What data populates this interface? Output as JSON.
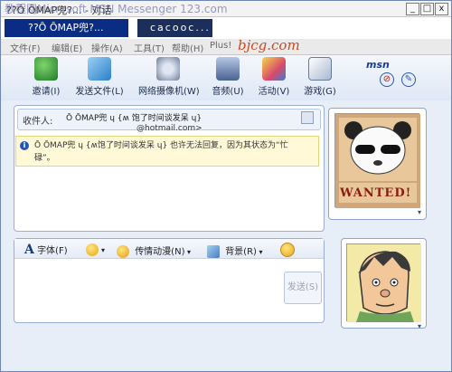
{
  "titlebar": {
    "title": "??Ȏ ȎMAP兜?... - 对话",
    "watermark": "教程网Microsoft MSN Messenger 123.com",
    "min_icon": "_",
    "max_icon": "□",
    "close_icon": "x"
  },
  "tabs": [
    {
      "label": "??Ȏ ȎMAP兜?..."
    },
    {
      "label": "cacooc..."
    }
  ],
  "menubar": {
    "items": [
      "文件(F)",
      "编辑(E)",
      "操作(A)",
      "工具(T)",
      "帮助(H)",
      "Plus!"
    ],
    "watermark": "bjcg.com"
  },
  "toolbar": {
    "items": [
      {
        "label": "邀请(I)"
      },
      {
        "label": "发送文件(L)"
      },
      {
        "label": "网络摄像机(W)"
      },
      {
        "label": "音频(U)"
      },
      {
        "label": "活动(V)"
      },
      {
        "label": "游戏(G)"
      }
    ],
    "msn_logo": "msn"
  },
  "conversation": {
    "to_label": "收件人:",
    "to_name": "Ȏ ȎMAP兜 ɥ {ʍ 饱了时间谈发呆 ɥ}",
    "to_email": "@hotmail.com>",
    "alert_text": "Ȏ ȎMAP兜 ɥ {ʍ饱了时间谈发呆 ɥ} 也许无法回复，因为其状态为“忙碌”。"
  },
  "format_toolbar": {
    "font": "字体(F)",
    "emotion": "传情动漫(N)",
    "background": "背景(R)"
  },
  "send_button": "发送(S)",
  "avatars": {
    "contact_caption": "WANTED!"
  }
}
